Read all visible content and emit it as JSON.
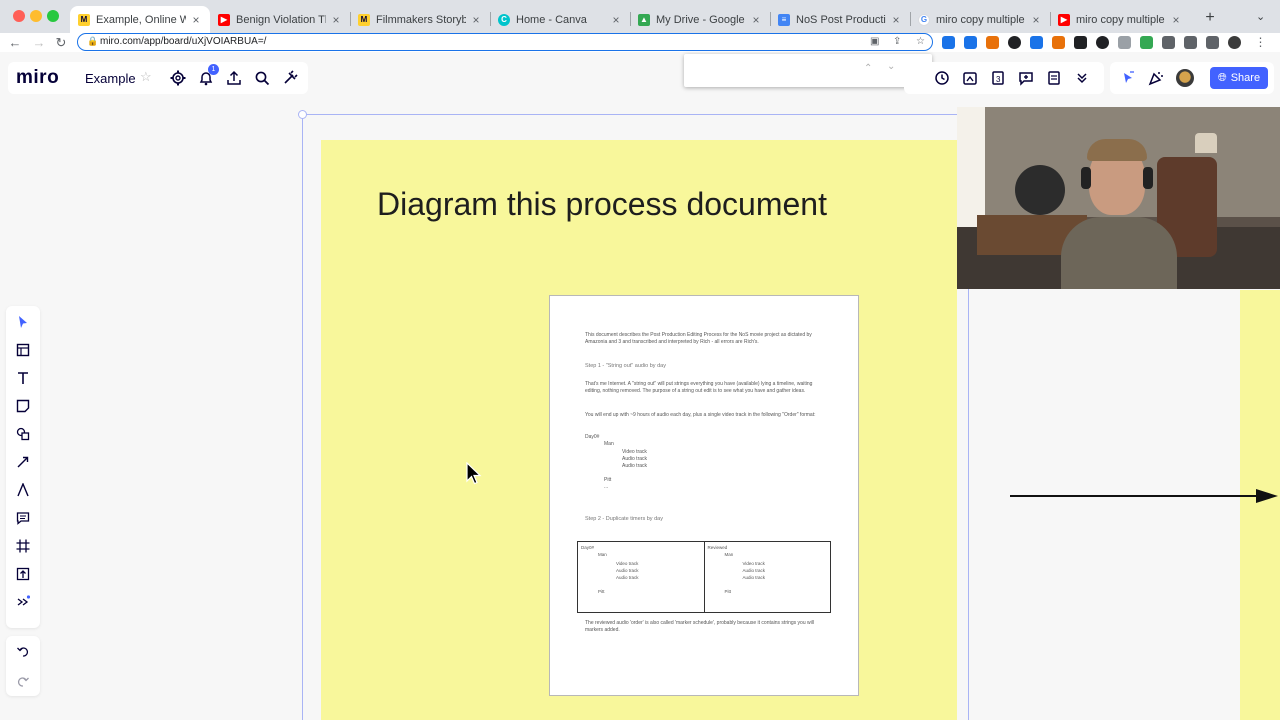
{
  "browser": {
    "tabs": [
      {
        "title": "Example, Online Whiteb",
        "fav_color": "#ffd02f",
        "fav_text": "M",
        "active": true
      },
      {
        "title": "Benign Violation Theory",
        "fav_color": "#ff0000",
        "fav_text": "▶"
      },
      {
        "title": "Filmmakers Storyboard",
        "fav_color": "#ffd02f",
        "fav_text": "M"
      },
      {
        "title": "Home - Canva",
        "fav_color": "#00c4cc",
        "fav_text": "C"
      },
      {
        "title": "My Drive - Google Drive",
        "fav_color": "#34a853",
        "fav_text": "▲"
      },
      {
        "title": "NoS Post Production Ed",
        "fav_color": "#4285f4",
        "fav_text": "≡"
      },
      {
        "title": "miro copy multiple item",
        "fav_color": "#4285f4",
        "fav_text": "G"
      },
      {
        "title": "miro copy multiple - Yo",
        "fav_color": "#ff0000",
        "fav_text": "▶"
      }
    ],
    "tab_close": "×",
    "new_tab": "+",
    "url": "miro.com/app/board/uXjVOIARBUA=/",
    "nav": {
      "back": "←",
      "forward": "→",
      "reload": "↻"
    },
    "extension_colors": [
      "#1a73e8",
      "#1a73e8",
      "#e8710a",
      "#202124",
      "#1a73e8",
      "#e8710a",
      "#202124",
      "#9aa0a6",
      "#34a853",
      "#5f6368",
      "#5f6368",
      "#5f6368"
    ]
  },
  "miro": {
    "logo": "miro",
    "board_name": "Example",
    "star": "☆",
    "notification_count": "1",
    "share_label": "Share",
    "find_placeholder": ""
  },
  "canvas": {
    "sticky_headline": "Diagram this process document",
    "document": {
      "intro": "This document describes the Post Production Editing Process for the NoS movie project as dictated by Amazonia and 3 and transcribed and interpreted by Rich - all errors are Rich's.",
      "step1_heading": "Step 1 - \"String out\" audio by day",
      "step1_body": "That's me Internet. A \"string out\" will put strings everything you have (available) lying a timeline, waiting editing, nothing removed. The purpose of a string out edit is to see what you have and gather ideas.",
      "step1_body2": "You will end up with ~9 hours of audio each day, plus a single video track in the following \"Order\" format:",
      "step1_list": [
        "Day0#",
        "Man",
        "Video track",
        "Audio track",
        "Audio track",
        "Pitt",
        "..."
      ],
      "step2_heading": "Step 2 - Duplicate timers by day",
      "table": [
        [
          "Day0#",
          "Man",
          "Video track",
          "Audio track",
          "Audio track",
          "Pitt"
        ],
        [
          "Reviewed",
          "Man",
          "Video track",
          "Audio track",
          "Audio track",
          "Pitt"
        ]
      ],
      "footer": "The reviewed audio 'order' is also called 'marker schedule', probably because it contains strings you will markers added."
    }
  }
}
